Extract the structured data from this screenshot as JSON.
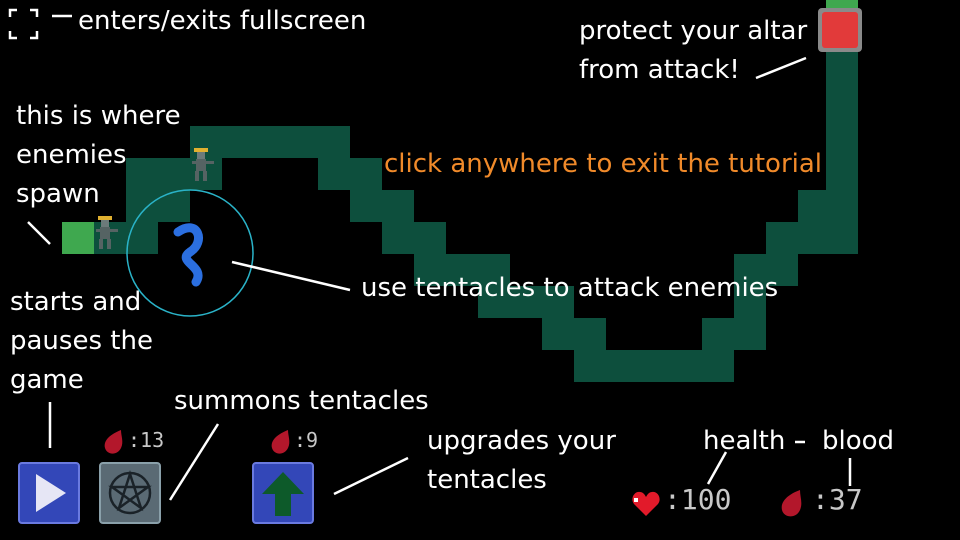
{
  "tutorial": {
    "fullscreen_hint": "enters/exits fullscreen",
    "altar_hint_line1": "protect your altar",
    "altar_hint_line2": "from attack!",
    "spawn_hint_line1": "this is where",
    "spawn_hint_line2": "enemies",
    "spawn_hint_line3": "spawn",
    "exit_hint": "click anywhere to exit the tutorial",
    "tentacle_hint": "use tentacles to attack enemies",
    "play_hint_line1": "starts and",
    "play_hint_line2": "pauses the",
    "play_hint_line3": "game",
    "summon_hint": "summons tentacles",
    "upgrade_hint_line1": "upgrades your",
    "upgrade_hint_line2": "tentacles",
    "health_label": "health",
    "blood_label": "blood"
  },
  "hud": {
    "summon_cost": ":13",
    "upgrade_cost": ":9",
    "health_value": ":100",
    "blood_value": ":37"
  },
  "colors": {
    "path": "#0d4f3d",
    "spawn": "#3fa84f",
    "altar": "#e23a3a",
    "exit_hint": "#f08a2a",
    "button_blue": "#3347b8",
    "tentacle": "#2b6fe0"
  },
  "icons": [
    "fullscreen-icon",
    "play-icon",
    "pentagram-icon",
    "up-arrow-icon",
    "blood-drop-icon",
    "heart-icon",
    "tentacle-icon",
    "enemy-icon"
  ]
}
